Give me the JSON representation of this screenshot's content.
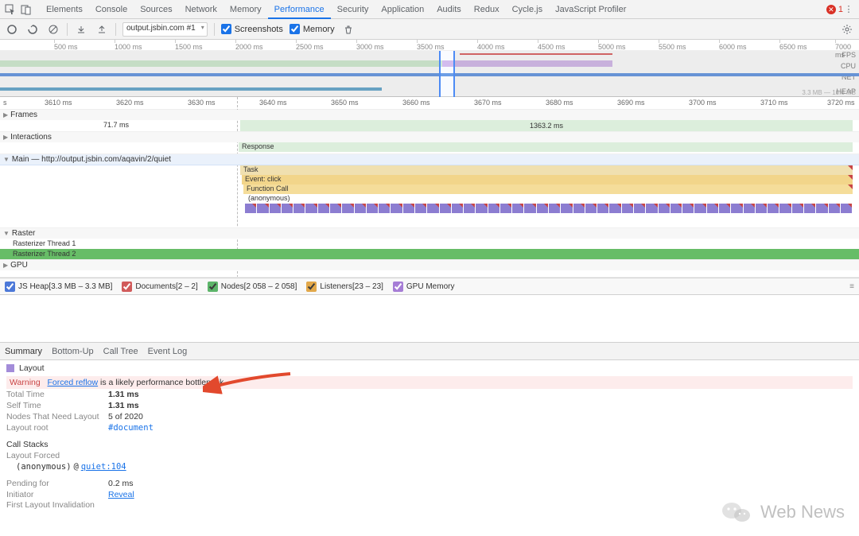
{
  "tabs": {
    "elements": "Elements",
    "console": "Console",
    "sources": "Sources",
    "network": "Network",
    "memory": "Memory",
    "performance": "Performance",
    "security": "Security",
    "application": "Application",
    "audits": "Audits",
    "redux": "Redux",
    "cyclejs": "Cycle.js",
    "jsprofiler": "JavaScript Profiler"
  },
  "errors": {
    "count": "1"
  },
  "toolbar": {
    "recording": "output.jsbin.com #1",
    "screenshots": "Screenshots",
    "memory": "Memory"
  },
  "overview": {
    "ticks": [
      "500 ms",
      "1000 ms",
      "1500 ms",
      "2000 ms",
      "2500 ms",
      "3000 ms",
      "3500 ms",
      "4000 ms",
      "4500 ms",
      "5000 ms",
      "5500 ms",
      "6000 ms",
      "6500 ms",
      "7000 ms"
    ],
    "labels": {
      "fps": "FPS",
      "cpu": "CPU",
      "net": "NET",
      "heap": "HEAP"
    },
    "heap_range": "3.3 MB — 10.6 MB"
  },
  "flame": {
    "ticks": [
      "s",
      "3610 ms",
      "3620 ms",
      "3630 ms",
      "3640 ms",
      "3650 ms",
      "3660 ms",
      "3670 ms",
      "3680 ms",
      "3690 ms",
      "3700 ms",
      "3710 ms",
      "3720 ms"
    ],
    "frames": {
      "label": "Frames",
      "v1": "71.7 ms",
      "v2": "1363.2 ms"
    },
    "interactions": {
      "label": "Interactions",
      "response": "Response"
    },
    "main": {
      "label": "Main — http://output.jsbin.com/aqavin/2/quiet",
      "task": "Task",
      "event": "Event: click",
      "call": "Function Call",
      "anon": "(anonymous)"
    },
    "raster": {
      "label": "Raster",
      "t1": "Rasterizer Thread 1",
      "t2": "Rasterizer Thread 2"
    },
    "gpu": {
      "label": "GPU"
    }
  },
  "metrics": {
    "heap": "JS Heap[3.3 MB – 3.3 MB]",
    "docs": "Documents[2 – 2]",
    "nodes": "Nodes[2 058 – 2 058]",
    "listeners": "Listeners[23 – 23]",
    "gpu": "GPU Memory"
  },
  "bottom_tabs": {
    "summary": "Summary",
    "bottomup": "Bottom-Up",
    "calltree": "Call Tree",
    "eventlog": "Event Log"
  },
  "details": {
    "title": "Layout",
    "warning_label": "Warning",
    "warning_link": "Forced reflow",
    "warning_text": "is a likely performance bottleneck.",
    "total_label": "Total Time",
    "total": "1.31 ms",
    "self_label": "Self Time",
    "self": "1.31 ms",
    "nodes_label": "Nodes That Need Layout",
    "nodes": "5 of 2020",
    "root_label": "Layout root",
    "root": "#document",
    "callstacks": "Call Stacks",
    "forced": "Layout Forced",
    "anon": "(anonymous)",
    "at": "@",
    "loc": "quiet:104",
    "pending_label": "Pending for",
    "pending": "0.2 ms",
    "initiator_label": "Initiator",
    "reveal": "Reveal",
    "first_inv": "First Layout Invalidation"
  },
  "watermark": "Web News"
}
